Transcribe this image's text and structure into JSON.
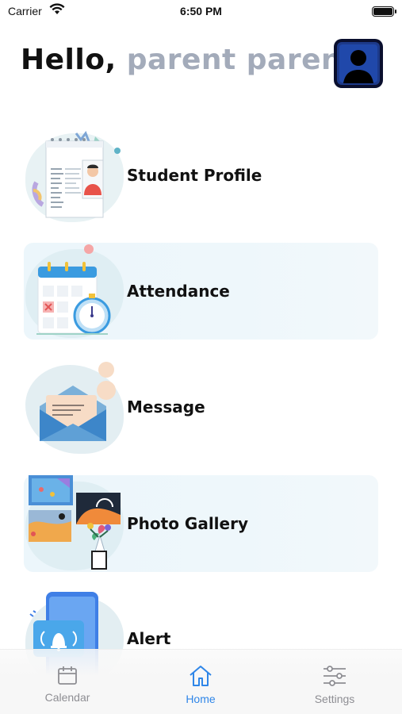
{
  "status_bar": {
    "carrier": "Carrier",
    "time": "6:50 PM"
  },
  "header": {
    "greeting": "Hello,",
    "user_name": "parent pareni"
  },
  "menu": [
    {
      "label": "Student Profile"
    },
    {
      "label": "Attendance"
    },
    {
      "label": "Message"
    },
    {
      "label": "Photo Gallery"
    },
    {
      "label": "Alert"
    }
  ],
  "tabs": [
    {
      "label": "Calendar",
      "icon": "calendar-icon"
    },
    {
      "label": "Home",
      "icon": "home-icon",
      "active": true
    },
    {
      "label": "Settings",
      "icon": "sliders-icon"
    }
  ],
  "colors": {
    "accent": "#2f86e8",
    "inactive": "#8e8e93",
    "name_grey": "#a3abba",
    "card_tint": "#ecf6fb"
  }
}
